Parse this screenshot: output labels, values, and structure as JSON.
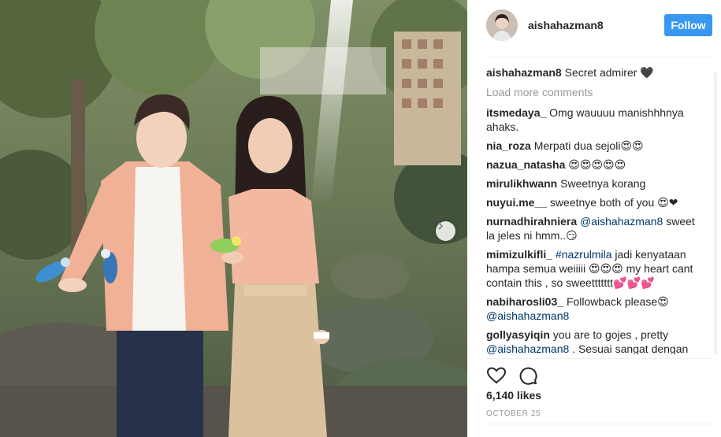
{
  "post": {
    "owner": "aishahazman8",
    "follow_label": "Follow"
  },
  "caption": {
    "user": "aishahazman8",
    "text": "Secret admirer 🖤"
  },
  "load_more_label": "Load more comments",
  "comments": [
    {
      "user": "itsmedaya_",
      "text": "Omg wauuuu manishhhnya ahaks."
    },
    {
      "user": "nia_roza",
      "text": "Merpati dua sejoli😍😍"
    },
    {
      "user": "nazua_natasha",
      "text": "😍😍😍😍😍"
    },
    {
      "user": "mirulikhwann",
      "text": "Sweetnya korang"
    },
    {
      "user": "nuyui.me__",
      "text": "sweetnye both of you 😍❤"
    },
    {
      "user": "nurnadhirahniera",
      "mention": "@aishahazman8",
      "text": "sweet la jeles ni hmm..😏"
    },
    {
      "user": "mimizulkifli_",
      "mention": "#nazrulmila",
      "text": "jadi kenyataan hampa semua weiiiii 😍😍😍 my heart cant contain this , so sweettttttt💕💕💕"
    },
    {
      "user": "nabiharosli03_",
      "text": "Followback please😍",
      "mention_after": "@aishahazman8"
    },
    {
      "user": "gollyasyiqin",
      "text": "you are to gojes , pretty",
      "mention_after": "@aishahazman8",
      "text_after": ". Sesuai sangat dengan"
    }
  ],
  "likes": "6,140 likes",
  "date": "OCTOBER 25",
  "icons": {
    "like": "heart-outline-icon",
    "comment": "speech-bubble-icon",
    "next": "chevron-right-icon"
  },
  "colors": {
    "follow_button": "#3897f0",
    "link": "#003569",
    "muted": "#999999"
  }
}
